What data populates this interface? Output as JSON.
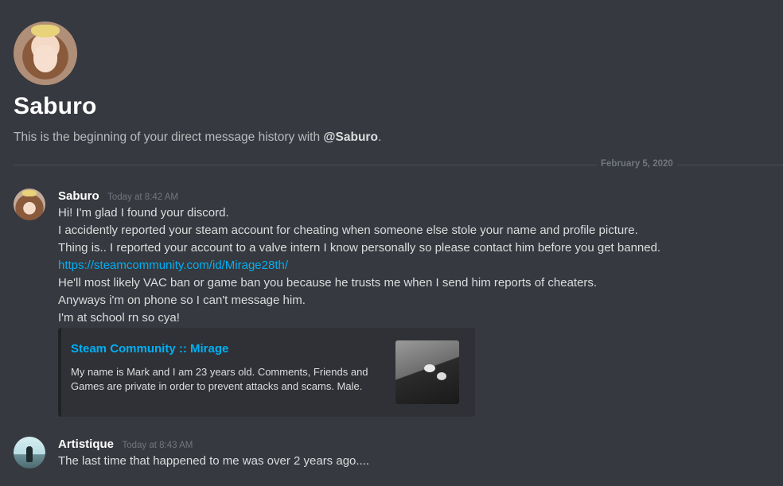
{
  "header": {
    "title": "Saburo",
    "subtitle_prefix": "This is the beginning of your direct message history with ",
    "subtitle_handle": "@Saburo",
    "subtitle_suffix": "."
  },
  "divider": {
    "date": "February 5, 2020"
  },
  "messages": [
    {
      "author": "Saburo",
      "timestamp": "Today at 8:42 AM",
      "lines": [
        "Hi! I'm glad I found your discord.",
        "I accidently reported your steam account for cheating when someone else stole your name and profile picture.",
        "Thing is.. I reported your account to a valve intern I know personally so please contact him before you get banned.",
        "https://steamcommunity.com/id/Mirage28th/",
        "He'll most likely VAC ban or game ban you because he trusts me when I send him reports of cheaters.",
        "Anyways i'm on phone so I can't message him.",
        "I'm at school rn so cya!"
      ],
      "embed": {
        "title": "Steam Community :: Mirage",
        "description": "My name is Mark and I am 23 years old. Comments, Friends and Games are private in order to prevent attacks and scams. Male."
      }
    },
    {
      "author": "Artistique",
      "timestamp": "Today at 8:43 AM",
      "lines": [
        "The last time that happened to me was over 2 years ago...."
      ]
    }
  ],
  "colors": {
    "background": "#36393f",
    "link": "#00b0f4",
    "embed_bg": "#2f3136",
    "muted": "#72767d"
  },
  "icons": {
    "saburo_avatar": "anime-girl-avatar",
    "artistique_avatar": "person-silhouette-avatar",
    "embed_thumbnail": "sneakers-photo"
  }
}
